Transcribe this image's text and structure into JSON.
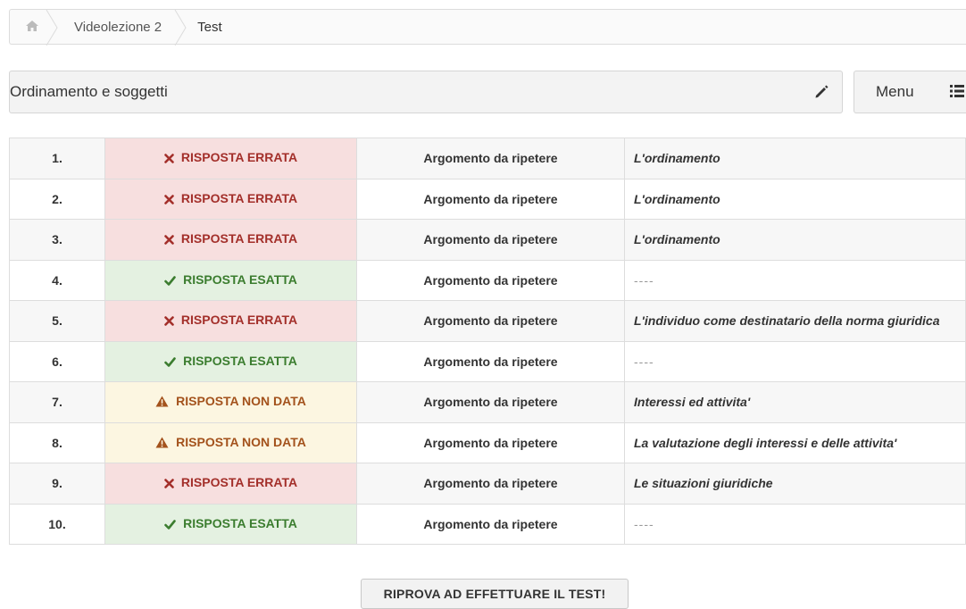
{
  "breadcrumb": {
    "home_icon": "home-icon",
    "items": [
      {
        "label": "Videolezione 2"
      },
      {
        "label": "Test"
      }
    ]
  },
  "header": {
    "title": "Ordinamento e soggetti",
    "edit_icon": "pencil-icon",
    "menu_label": "Menu",
    "menu_icon": "list-icon"
  },
  "colors": {
    "error_bg": "#f7dfdf",
    "error_text": "#a32f2a",
    "ok_bg": "#e4f1e1",
    "ok_text": "#3b7d2f",
    "na_bg": "#fcf6e1",
    "na_text": "#a3521c"
  },
  "results": [
    {
      "num": "1.",
      "status": "RISPOSTA ERRATA",
      "kind": "err",
      "icon": "x-icon",
      "argument": "Argomento da ripetere",
      "topic": "L'ordinamento"
    },
    {
      "num": "2.",
      "status": "RISPOSTA ERRATA",
      "kind": "err",
      "icon": "x-icon",
      "argument": "Argomento da ripetere",
      "topic": "L'ordinamento"
    },
    {
      "num": "3.",
      "status": "RISPOSTA ERRATA",
      "kind": "err",
      "icon": "x-icon",
      "argument": "Argomento da ripetere",
      "topic": "L'ordinamento"
    },
    {
      "num": "4.",
      "status": "RISPOSTA ESATTA",
      "kind": "ok",
      "icon": "check-icon",
      "argument": "Argomento da ripetere",
      "topic": "----"
    },
    {
      "num": "5.",
      "status": "RISPOSTA ERRATA",
      "kind": "err",
      "icon": "x-icon",
      "argument": "Argomento da ripetere",
      "topic": "L'individuo come destinatario della norma giuridica"
    },
    {
      "num": "6.",
      "status": "RISPOSTA ESATTA",
      "kind": "ok",
      "icon": "check-icon",
      "argument": "Argomento da ripetere",
      "topic": "----"
    },
    {
      "num": "7.",
      "status": "RISPOSTA NON DATA",
      "kind": "na",
      "icon": "warning-icon",
      "argument": "Argomento da ripetere",
      "topic": "Interessi ed attivita'"
    },
    {
      "num": "8.",
      "status": "RISPOSTA NON DATA",
      "kind": "na",
      "icon": "warning-icon",
      "argument": "Argomento da ripetere",
      "topic": "La valutazione degli interessi e delle attivita'"
    },
    {
      "num": "9.",
      "status": "RISPOSTA ERRATA",
      "kind": "err",
      "icon": "x-icon",
      "argument": "Argomento da ripetere",
      "topic": "Le situazioni giuridiche"
    },
    {
      "num": "10.",
      "status": "RISPOSTA ESATTA",
      "kind": "ok",
      "icon": "check-icon",
      "argument": "Argomento da ripetere",
      "topic": "----"
    }
  ],
  "retry_button": "RIPROVA AD EFFETTUARE IL TEST!"
}
